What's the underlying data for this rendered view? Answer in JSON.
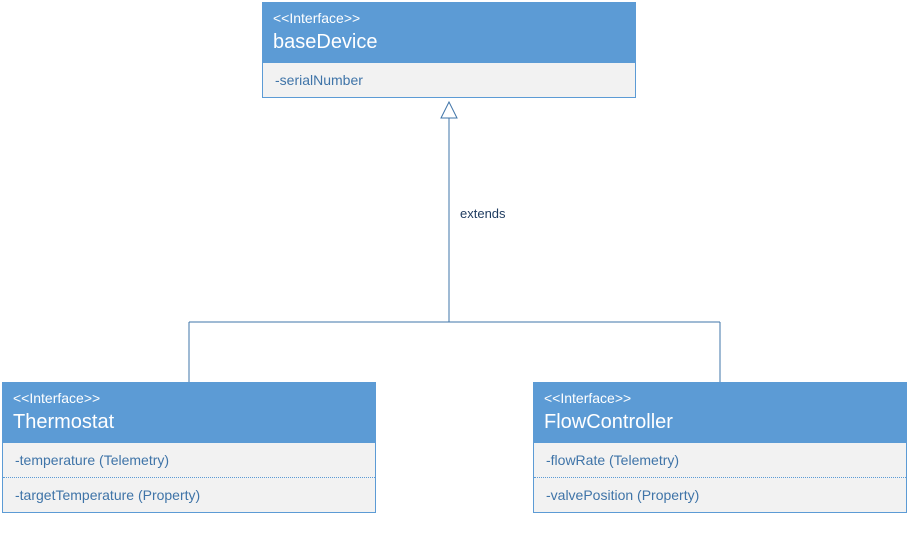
{
  "base": {
    "stereo": "<<Interface>>",
    "name": "baseDevice",
    "attr1": "-serialNumber"
  },
  "thermostat": {
    "stereo": "<<Interface>>",
    "name": "Thermostat",
    "attr1": "-temperature (Telemetry)",
    "attr2": "-targetTemperature (Property)"
  },
  "flow": {
    "stereo": "<<Interface>>",
    "name": "FlowController",
    "attr1": "-flowRate (Telemetry)",
    "attr2": "-valvePosition (Property)"
  },
  "edgeLabel": "extends"
}
